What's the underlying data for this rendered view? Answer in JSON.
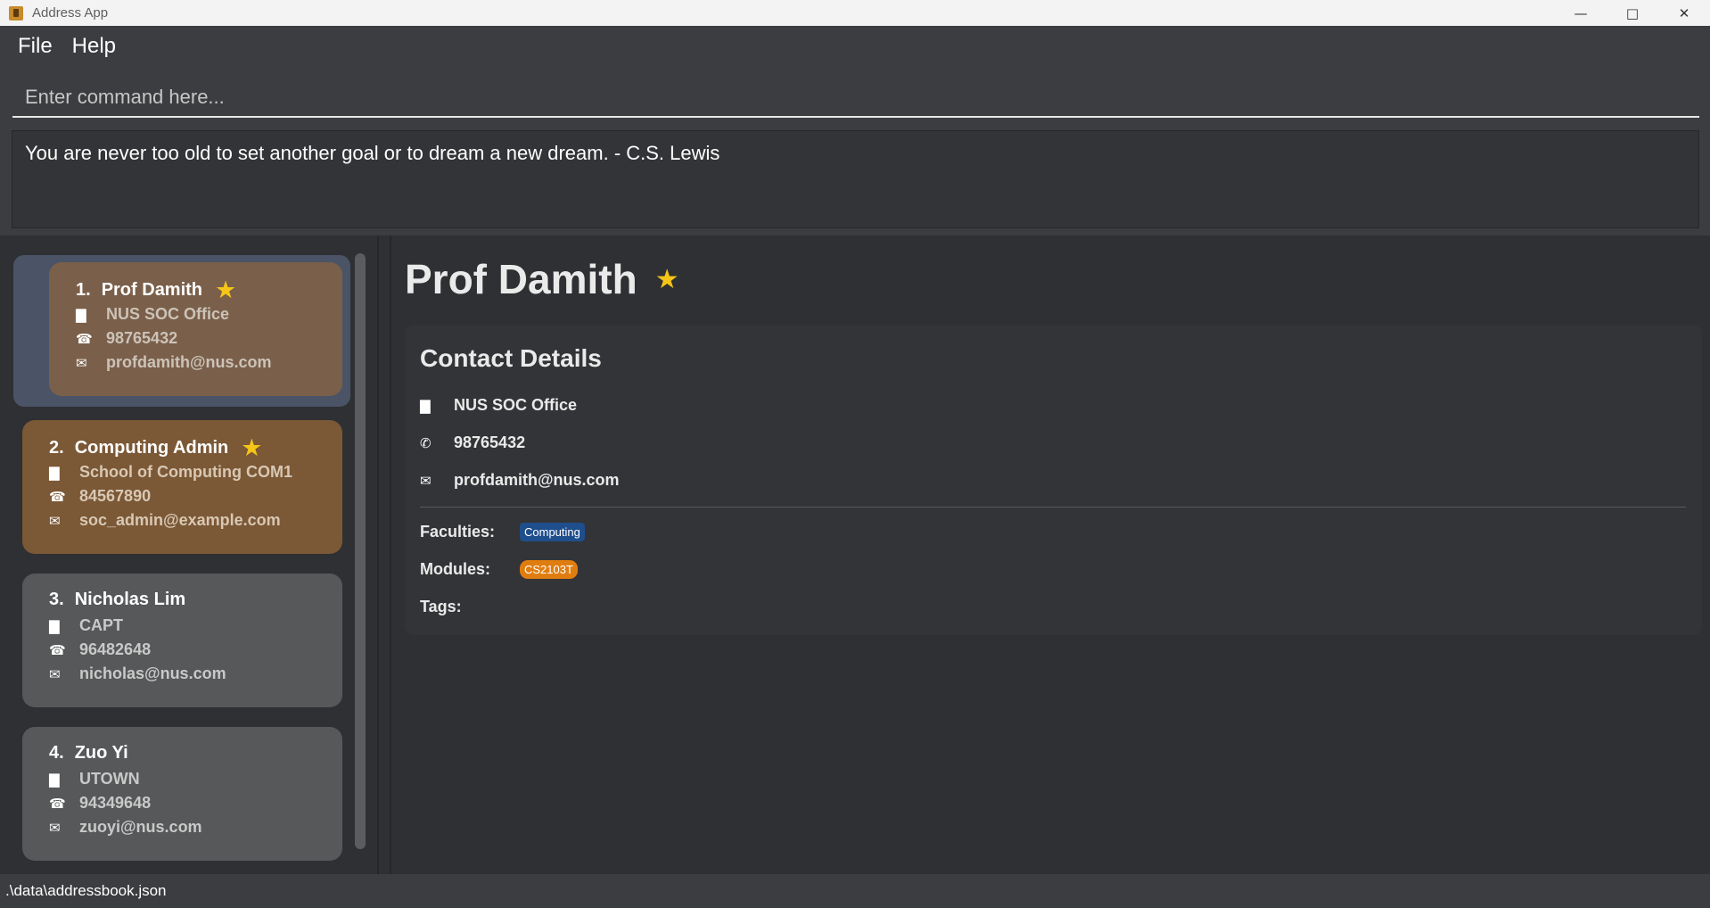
{
  "window": {
    "title": "Address App",
    "minimize": "—",
    "maximize": "□",
    "close": "✕"
  },
  "menu": {
    "file": "File",
    "help": "Help"
  },
  "command": {
    "placeholder": "Enter command here..."
  },
  "result": {
    "text": "You are never too old to set another goal or to dream a new dream. - C.S. Lewis"
  },
  "persons": [
    {
      "index": "1.",
      "name": "Prof Damith",
      "starred": true,
      "address": "NUS SOC Office",
      "phone": "98765432",
      "email": "profdamith@nus.com"
    },
    {
      "index": "2.",
      "name": "Computing Admin",
      "starred": true,
      "address": "School of Computing COM1",
      "phone": "84567890",
      "email": "soc_admin@example.com"
    },
    {
      "index": "3.",
      "name": "Nicholas Lim",
      "starred": false,
      "address": "CAPT",
      "phone": "96482648",
      "email": "nicholas@nus.com"
    },
    {
      "index": "4.",
      "name": "Zuo Yi",
      "starred": false,
      "address": "UTOWN",
      "phone": "94349648",
      "email": "zuoyi@nus.com"
    }
  ],
  "detail": {
    "name": "Prof Damith",
    "star": "★",
    "section_title": "Contact Details",
    "address": "NUS SOC Office",
    "phone": "98765432",
    "email": "profdamith@nus.com",
    "faculties_label": "Faculties:",
    "faculties": [
      "Computing"
    ],
    "modules_label": "Modules:",
    "modules": [
      "CS2103T"
    ],
    "tags_label": "Tags:"
  },
  "icons": {
    "star": "★",
    "building": "▇",
    "phone_card": "☎",
    "phone_detail": "✆",
    "mail": "✉"
  },
  "status": {
    "path": ".\\data\\addressbook.json"
  },
  "colors": {
    "accent_star": "#f5c518",
    "faculty_chip": "#1f4e8c",
    "module_chip": "#e07d10",
    "selected_bg": "#4a5466"
  }
}
